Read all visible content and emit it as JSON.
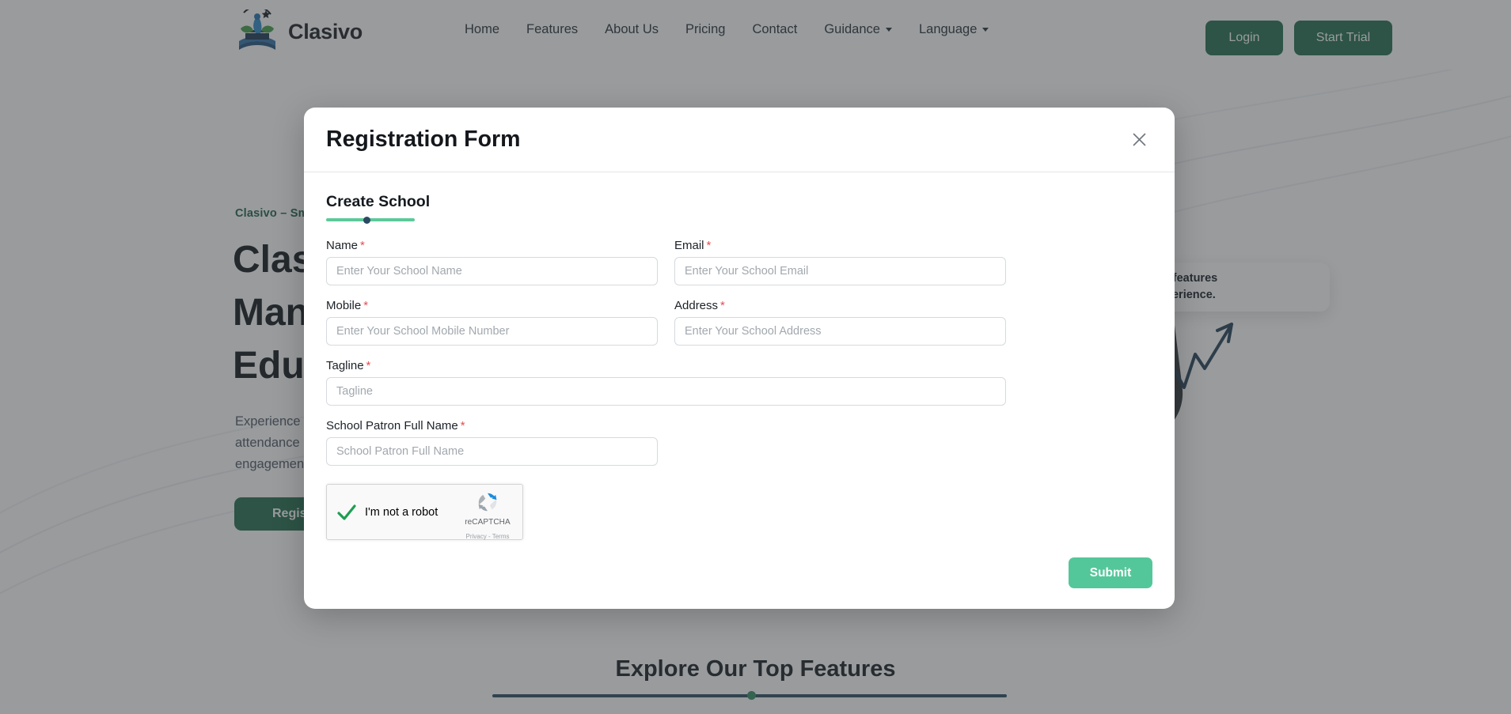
{
  "navbar": {
    "brand_name": "Clasivo",
    "logo_icon": "clasivo-book-logo",
    "links": [
      {
        "label": "Home",
        "caret": false
      },
      {
        "label": "Features",
        "caret": false
      },
      {
        "label": "About Us",
        "caret": false
      },
      {
        "label": "Pricing",
        "caret": false
      },
      {
        "label": "Contact",
        "caret": false
      },
      {
        "label": "Guidance",
        "caret": true
      },
      {
        "label": "Language",
        "caret": true
      }
    ],
    "login_label": "Login",
    "trial_label": "Start Trial"
  },
  "hero": {
    "kicker": "Clasivo – Sm",
    "title": "Clas\nMan\nEduc",
    "subtitle": "Experience\nattendance\nengagemen",
    "register_label": "Register",
    "art_card_text": "ust features\nexperience."
  },
  "features_section": {
    "heading": "Explore Our Top Features"
  },
  "modal": {
    "title": "Registration Form",
    "close_icon": "close-icon",
    "step": {
      "label": "Create School",
      "progress_percent": 46
    },
    "fields": [
      {
        "key": "name",
        "label": "Name",
        "required": true,
        "placeholder": "Enter Your School Name",
        "value": "",
        "col": "left"
      },
      {
        "key": "email",
        "label": "Email",
        "required": true,
        "placeholder": "Enter Your School Email",
        "value": "",
        "col": "right"
      },
      {
        "key": "mobile",
        "label": "Mobile",
        "required": true,
        "placeholder": "Enter Your School Mobile Number",
        "value": "",
        "col": "left"
      },
      {
        "key": "address",
        "label": "Address",
        "required": true,
        "placeholder": "Enter Your School Address",
        "value": "",
        "col": "right"
      },
      {
        "key": "tagline",
        "label": "Tagline",
        "required": true,
        "placeholder": "Tagline",
        "value": "",
        "col": "full"
      },
      {
        "key": "patron",
        "label": "School Patron Full Name",
        "required": true,
        "placeholder": "School Patron Full Name",
        "value": "",
        "col": "left"
      }
    ],
    "recaptcha": {
      "label": "I'm not a robot",
      "checked": true,
      "brand_name": "reCAPTCHA",
      "legal": "Privacy - Terms",
      "logo_icon": "recaptcha-logo-icon",
      "check_icon": "checkmark-icon"
    },
    "submit_label": "Submit"
  },
  "colors": {
    "brand_green": "#1e6b4a",
    "submit_green": "#54c79a",
    "progress_green": "#5cc99a",
    "required_red": "#e74c50",
    "rule_navy": "#24485c"
  }
}
